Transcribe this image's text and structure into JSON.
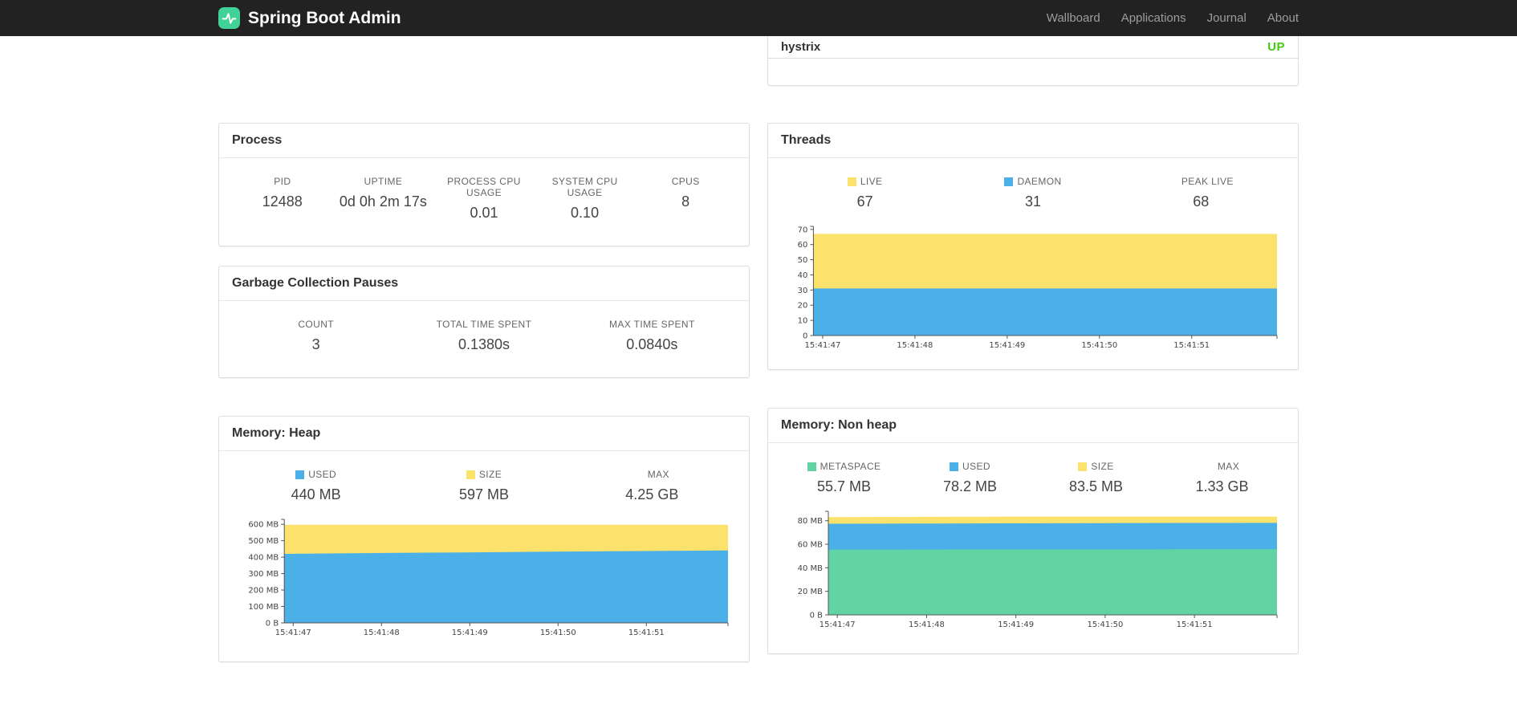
{
  "navbar": {
    "brand": "Spring Boot Admin",
    "links": [
      {
        "label": "Wallboard"
      },
      {
        "label": "Applications"
      },
      {
        "label": "Journal"
      },
      {
        "label": "About"
      }
    ]
  },
  "health": {
    "rows": [
      {
        "name": "hystrix",
        "status": "UP"
      }
    ],
    "status_color": "#44cc11"
  },
  "colors": {
    "brand_green": "#40d296",
    "series_yellow": "#fbe26d",
    "series_blue": "#4cb0e8",
    "series_green": "#62d4a3"
  },
  "panels": {
    "process": {
      "title": "Process",
      "stats": [
        {
          "label": "PID",
          "value": "12488"
        },
        {
          "label": "UPTIME",
          "value": "0d 0h 2m 17s"
        },
        {
          "label": "PROCESS CPU USAGE",
          "value": "0.01"
        },
        {
          "label": "SYSTEM CPU USAGE",
          "value": "0.10"
        },
        {
          "label": "CPUS",
          "value": "8"
        }
      ]
    },
    "gc": {
      "title": "Garbage Collection Pauses",
      "stats": [
        {
          "label": "COUNT",
          "value": "3"
        },
        {
          "label": "TOTAL TIME SPENT",
          "value": "0.1380s"
        },
        {
          "label": "MAX TIME SPENT",
          "value": "0.0840s"
        }
      ]
    },
    "threads": {
      "title": "Threads",
      "stats": [
        {
          "label": "LIVE",
          "value": "67",
          "swatch": "#fbe26d"
        },
        {
          "label": "DAEMON",
          "value": "31",
          "swatch": "#4cb0e8"
        },
        {
          "label": "PEAK LIVE",
          "value": "68",
          "swatch": null
        }
      ]
    },
    "heap": {
      "title": "Memory: Heap",
      "stats": [
        {
          "label": "USED",
          "value": "440 MB",
          "swatch": "#4cb0e8"
        },
        {
          "label": "SIZE",
          "value": "597 MB",
          "swatch": "#fbe26d"
        },
        {
          "label": "MAX",
          "value": "4.25 GB",
          "swatch": null
        }
      ]
    },
    "nonheap": {
      "title": "Memory: Non heap",
      "stats": [
        {
          "label": "METASPACE",
          "value": "55.7 MB",
          "swatch": "#62d4a3"
        },
        {
          "label": "USED",
          "value": "78.2 MB",
          "swatch": "#4cb0e8"
        },
        {
          "label": "SIZE",
          "value": "83.5 MB",
          "swatch": "#fbe26d"
        },
        {
          "label": "MAX",
          "value": "1.33 GB",
          "swatch": null
        }
      ]
    }
  },
  "chart_data": [
    {
      "id": "threads",
      "type": "area",
      "title": "Threads",
      "ylim": [
        0,
        72
      ],
      "yticks": [
        {
          "v": 0,
          "label": "0"
        },
        {
          "v": 10,
          "label": "10"
        },
        {
          "v": 20,
          "label": "20"
        },
        {
          "v": 30,
          "label": "30"
        },
        {
          "v": 40,
          "label": "40"
        },
        {
          "v": 50,
          "label": "50"
        },
        {
          "v": 60,
          "label": "60"
        },
        {
          "v": 70,
          "label": "70"
        }
      ],
      "xticks": [
        {
          "pos": 0.02,
          "label": "15:41:47"
        },
        {
          "pos": 0.219,
          "label": "15:41:48"
        },
        {
          "pos": 0.418,
          "label": "15:41:49"
        },
        {
          "pos": 0.617,
          "label": "15:41:50"
        },
        {
          "pos": 0.816,
          "label": "15:41:51"
        }
      ],
      "series": [
        {
          "name": "LIVE",
          "color": "#fbe26d",
          "values": [
            67,
            67,
            67,
            67,
            67,
            67
          ]
        },
        {
          "name": "DAEMON",
          "color": "#4cb0e8",
          "values": [
            31,
            31,
            31,
            31,
            31,
            31
          ]
        }
      ]
    },
    {
      "id": "heap",
      "type": "area",
      "title": "Memory: Heap",
      "ylim": [
        0,
        630
      ],
      "yticks": [
        {
          "v": 0,
          "label": "0 B"
        },
        {
          "v": 100,
          "label": "100 MB"
        },
        {
          "v": 200,
          "label": "200 MB"
        },
        {
          "v": 300,
          "label": "300 MB"
        },
        {
          "v": 400,
          "label": "400 MB"
        },
        {
          "v": 500,
          "label": "500 MB"
        },
        {
          "v": 600,
          "label": "600 MB"
        }
      ],
      "xticks": [
        {
          "pos": 0.02,
          "label": "15:41:47"
        },
        {
          "pos": 0.219,
          "label": "15:41:48"
        },
        {
          "pos": 0.418,
          "label": "15:41:49"
        },
        {
          "pos": 0.617,
          "label": "15:41:50"
        },
        {
          "pos": 0.816,
          "label": "15:41:51"
        }
      ],
      "series": [
        {
          "name": "SIZE",
          "color": "#fbe26d",
          "values": [
            597,
            597,
            597,
            597,
            597,
            597
          ]
        },
        {
          "name": "USED",
          "color": "#4cb0e8",
          "values": [
            420,
            425,
            429,
            433,
            437,
            441
          ]
        }
      ]
    },
    {
      "id": "nonheap",
      "type": "area",
      "title": "Memory: Non heap",
      "ylim": [
        0,
        88
      ],
      "yticks": [
        {
          "v": 0,
          "label": "0 B"
        },
        {
          "v": 20,
          "label": "20 MB"
        },
        {
          "v": 40,
          "label": "40 MB"
        },
        {
          "v": 60,
          "label": "60 MB"
        },
        {
          "v": 80,
          "label": "80 MB"
        }
      ],
      "xticks": [
        {
          "pos": 0.02,
          "label": "15:41:47"
        },
        {
          "pos": 0.219,
          "label": "15:41:48"
        },
        {
          "pos": 0.418,
          "label": "15:41:49"
        },
        {
          "pos": 0.617,
          "label": "15:41:50"
        },
        {
          "pos": 0.816,
          "label": "15:41:51"
        }
      ],
      "series": [
        {
          "name": "SIZE",
          "color": "#fbe26d",
          "values": [
            83,
            83.3,
            83.5,
            83.5,
            83.5,
            83.5
          ]
        },
        {
          "name": "USED",
          "color": "#4cb0e8",
          "values": [
            77.4,
            77.6,
            77.8,
            78,
            78.1,
            78.2
          ]
        },
        {
          "name": "METASPACE",
          "color": "#62d4a3",
          "values": [
            55.4,
            55.5,
            55.6,
            55.6,
            55.7,
            55.7
          ]
        }
      ]
    }
  ]
}
